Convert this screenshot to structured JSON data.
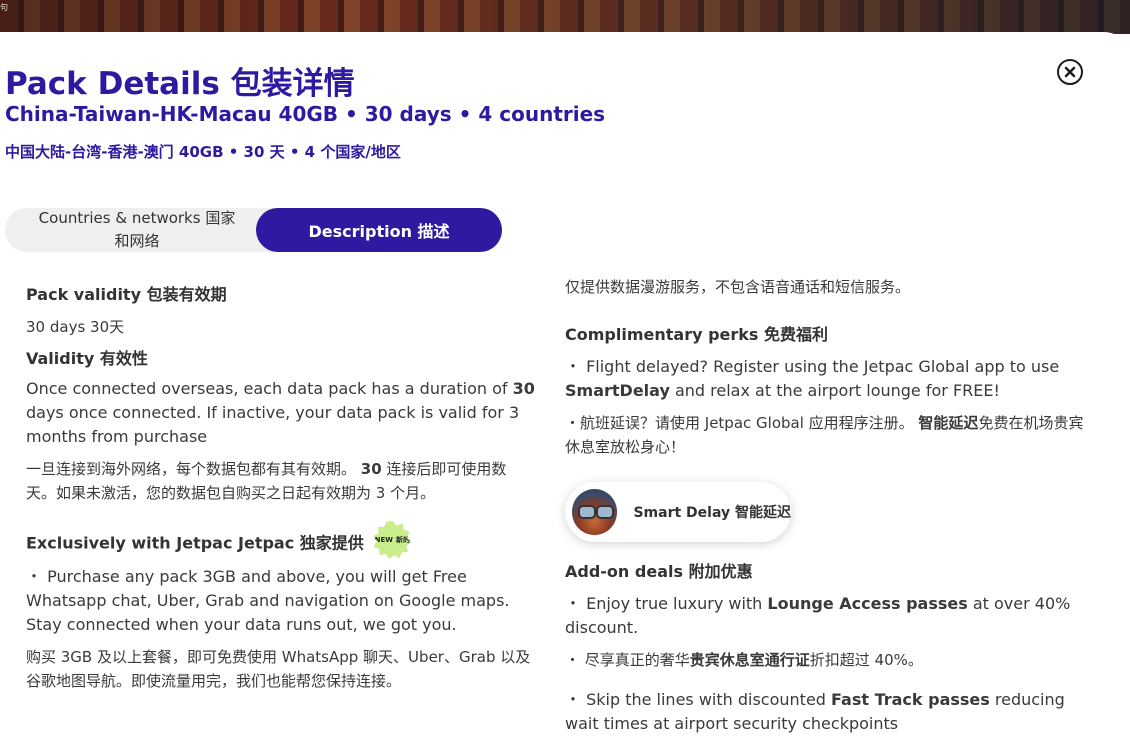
{
  "banner": {
    "tiny_text": "句"
  },
  "header": {
    "title": "Pack Details  包装详情",
    "subtitle_en": "China-Taiwan-HK-Macau 40GB  •  30 days  •  4 countries",
    "subtitle_zh": "中国大陆-台湾-香港-澳门 40GB  •  30 天  •  4 个国家/地区",
    "close_icon": "close-circle-icon"
  },
  "tabs": {
    "countries_label": "Countries & networks  国家和网络",
    "description_label": "Description  描述",
    "active": "description"
  },
  "left": {
    "pack_validity_heading": "Pack validity  包装有效期",
    "pack_validity_value": "30 days  30天",
    "validity_heading": "Validity  有效性",
    "validity_en_1": "Once connected overseas, each data pack has a duration of ",
    "validity_en_bold": "30",
    "validity_en_2": " days once connected. If inactive, your data pack is valid for 3 months from purchase",
    "validity_zh_1": "一旦连接到海外网络，每个数据包都有其有效期。 ",
    "validity_zh_bold": "30",
    "validity_zh_2": " 连接后即可使用数天。如果未激活，您的数据包自购买之日起有效期为 3 个月。",
    "exclusive_heading": "Exclusively with Jetpac  Jetpac 独家提供",
    "new_badge_en": "NEW",
    "new_badge_zh": "新的",
    "exclusive_en": "・ Purchase any pack 3GB and above, you will get Free Whatsapp chat, Uber, Grab and navigation on Google maps. Stay connected when your data runs out, we got you.",
    "exclusive_zh": "购买 3GB 及以上套餐，即可免费使用 WhatsApp 聊天、Uber、Grab 以及谷歌地图导航。即使流量用完，我们也能帮您保持连接。"
  },
  "right": {
    "data_only_zh": "仅提供数据漫游服务，不包含语音通话和短信服务。",
    "perks_heading": "Complimentary perks  免费福利",
    "perks_en_1": "・ Flight delayed? Register using the Jetpac Global app to use ",
    "perks_en_bold": "SmartDelay",
    "perks_en_2": " and relax at the airport lounge for FREE!",
    "perks_zh_1": "・航班延误？请使用 Jetpac Global 应用程序注册。 ",
    "perks_zh_bold": "智能延迟",
    "perks_zh_2": "免费在机场贵宾休息室放松身心！",
    "smart_delay_label": "Smart Delay  智能延迟",
    "addon_heading": "Add-on deals  附加优惠",
    "addon_1_a": "・ Enjoy true luxury with ",
    "addon_1_bold": "Lounge Access passes",
    "addon_1_b": " at over 40% discount.",
    "addon_2_a": "・ 尽享真正的奢华",
    "addon_2_bold": "贵宾休息室通行证",
    "addon_2_b": "折扣超过 40%。",
    "addon_3_a": "・ Skip the lines with discounted ",
    "addon_3_bold": "Fast Track passes",
    "addon_3_b": " reducing wait times at airport security checkpoints"
  },
  "colors": {
    "brand_purple": "#2e1aa0",
    "text": "#3a3a3a",
    "badge_green": "#c9ed8c"
  }
}
